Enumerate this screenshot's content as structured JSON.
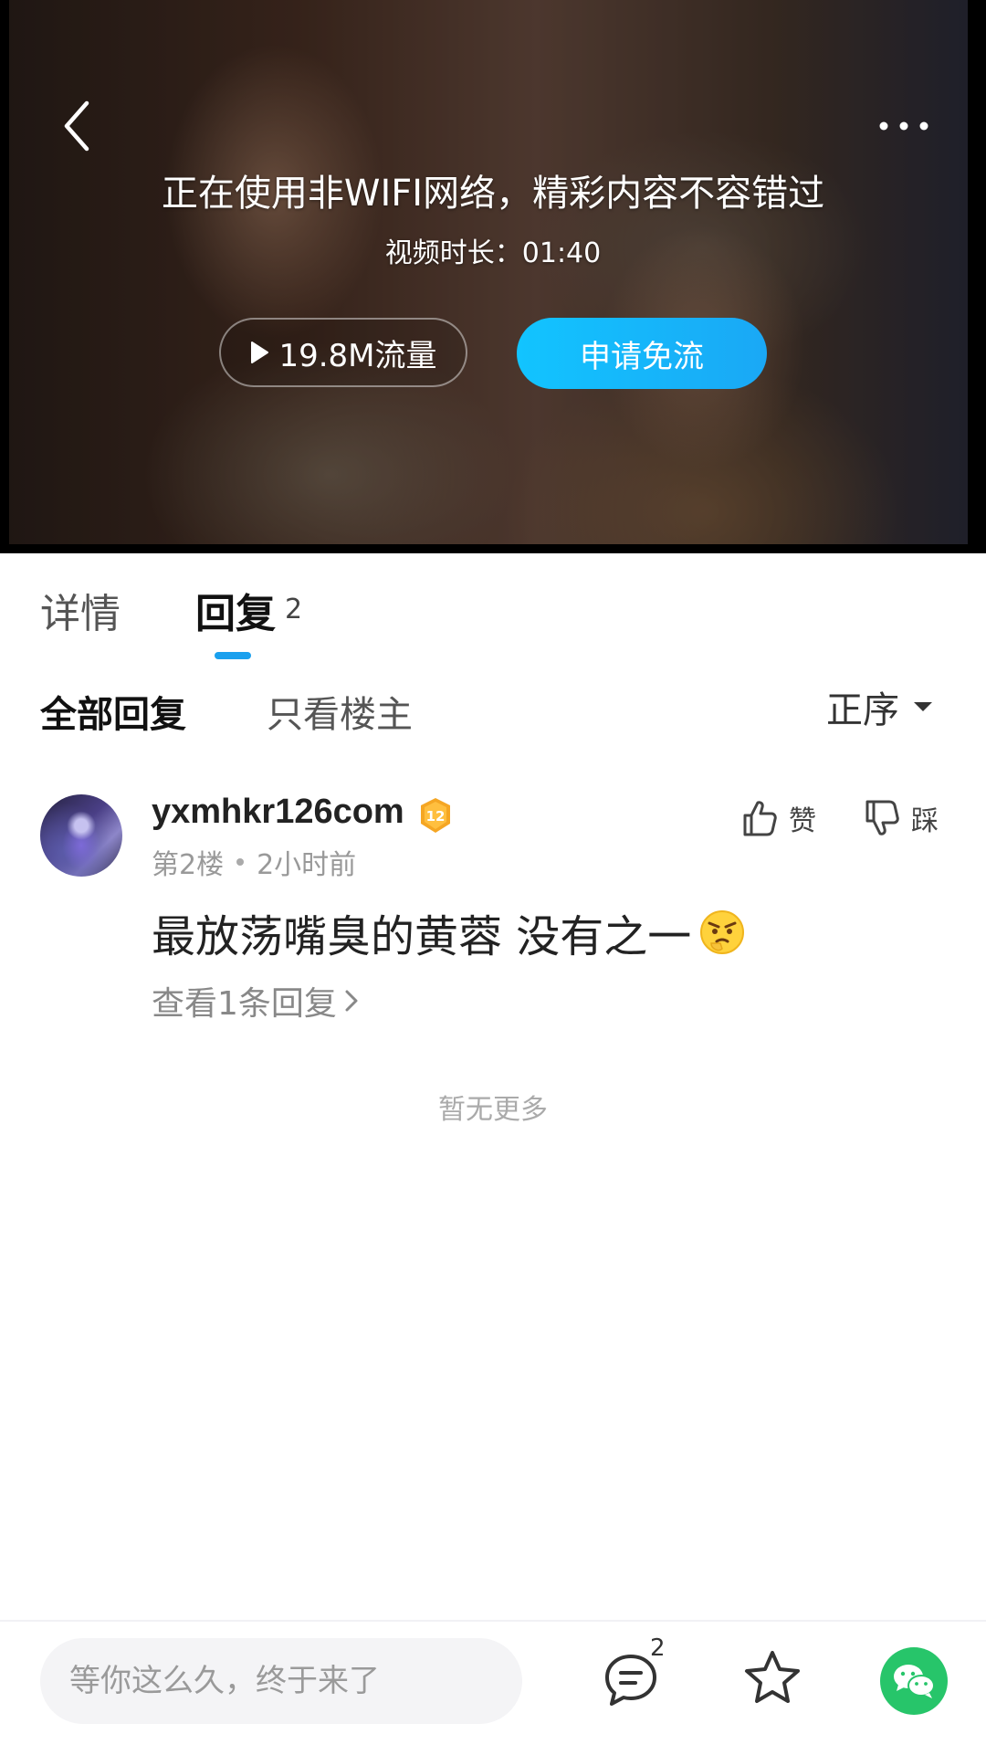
{
  "video": {
    "notice": "正在使用非WIFI网络，精彩内容不容错过",
    "duration_label": "视频时长：",
    "duration": "01:40",
    "flow_button": "19.8M流量",
    "free_button": "申请免流"
  },
  "tabs": {
    "detail": "详情",
    "reply": "回复",
    "reply_count": "2"
  },
  "filter": {
    "all": "全部回复",
    "owner_only": "只看楼主",
    "sort": "正序"
  },
  "comment": {
    "username": "yxmhkr126com",
    "level": "12",
    "floor": "第2楼",
    "time": "2小时前",
    "like_label": "赞",
    "dislike_label": "踩",
    "text": "最放荡嘴臭的黄蓉 没有之一",
    "view_replies": "查看1条回复"
  },
  "no_more": "暂无更多",
  "bottom": {
    "input_placeholder": "等你这么久，终于来了",
    "comment_count": "2"
  },
  "colors": {
    "accent": "#1aa0ee",
    "free_button": "#12c4ff",
    "badge": "#f5a623",
    "wechat": "#27c56a"
  },
  "icons": [
    "back-icon",
    "more-icon",
    "play-icon",
    "chevron-down-icon",
    "thumb-up-icon",
    "thumb-down-icon",
    "chevron-right-icon",
    "comment-icon",
    "star-icon",
    "wechat-icon"
  ]
}
